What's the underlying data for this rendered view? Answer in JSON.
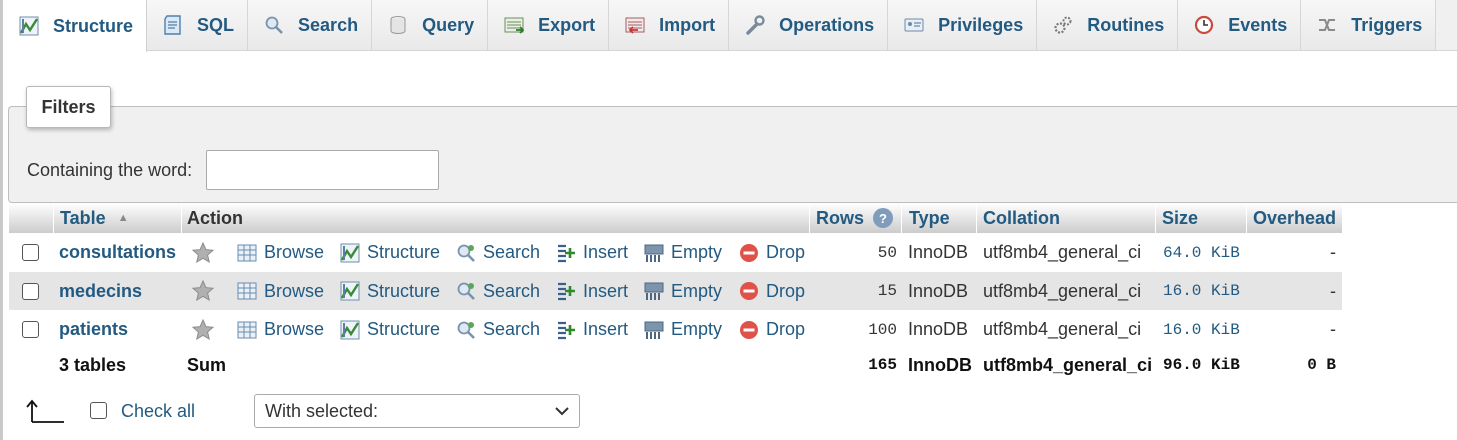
{
  "tabs": [
    {
      "label": "Structure",
      "icon": "structure-icon",
      "active": true
    },
    {
      "label": "SQL",
      "icon": "sql-icon"
    },
    {
      "label": "Search",
      "icon": "search-icon"
    },
    {
      "label": "Query",
      "icon": "query-icon"
    },
    {
      "label": "Export",
      "icon": "export-icon"
    },
    {
      "label": "Import",
      "icon": "import-icon"
    },
    {
      "label": "Operations",
      "icon": "wrench-icon"
    },
    {
      "label": "Privileges",
      "icon": "privileges-icon"
    },
    {
      "label": "Routines",
      "icon": "routines-icon"
    },
    {
      "label": "Events",
      "icon": "clock-icon"
    },
    {
      "label": "Triggers",
      "icon": "triggers-icon"
    }
  ],
  "filters": {
    "legend": "Filters",
    "label": "Containing the word:",
    "value": "",
    "placeholder": ""
  },
  "table": {
    "headers": {
      "table": "Table",
      "action": "Action",
      "rows": "Rows",
      "type": "Type",
      "collation": "Collation",
      "size": "Size",
      "overhead": "Overhead"
    },
    "action_labels": {
      "browse": "Browse",
      "structure": "Structure",
      "search": "Search",
      "insert": "Insert",
      "empty": "Empty",
      "drop": "Drop"
    },
    "rows": [
      {
        "name": "consultations",
        "rows": "50",
        "type": "InnoDB",
        "collation": "utf8mb4_general_ci",
        "size": "64.0 KiB",
        "overhead": "-"
      },
      {
        "name": "medecins",
        "rows": "15",
        "type": "InnoDB",
        "collation": "utf8mb4_general_ci",
        "size": "16.0 KiB",
        "overhead": "-"
      },
      {
        "name": "patients",
        "rows": "100",
        "type": "InnoDB",
        "collation": "utf8mb4_general_ci",
        "size": "16.0 KiB",
        "overhead": "-"
      }
    ],
    "summary": {
      "tables": "3 tables",
      "label": "Sum",
      "rows": "165",
      "type": "InnoDB",
      "collation": "utf8mb4_general_ci",
      "size": "96.0 KiB",
      "overhead": "0 B"
    }
  },
  "footer": {
    "check_all": "Check all",
    "with_selected": "With selected:"
  },
  "colors": {
    "link": "#235a81",
    "drop": "#e0514a",
    "star": "#a8a8a8"
  }
}
